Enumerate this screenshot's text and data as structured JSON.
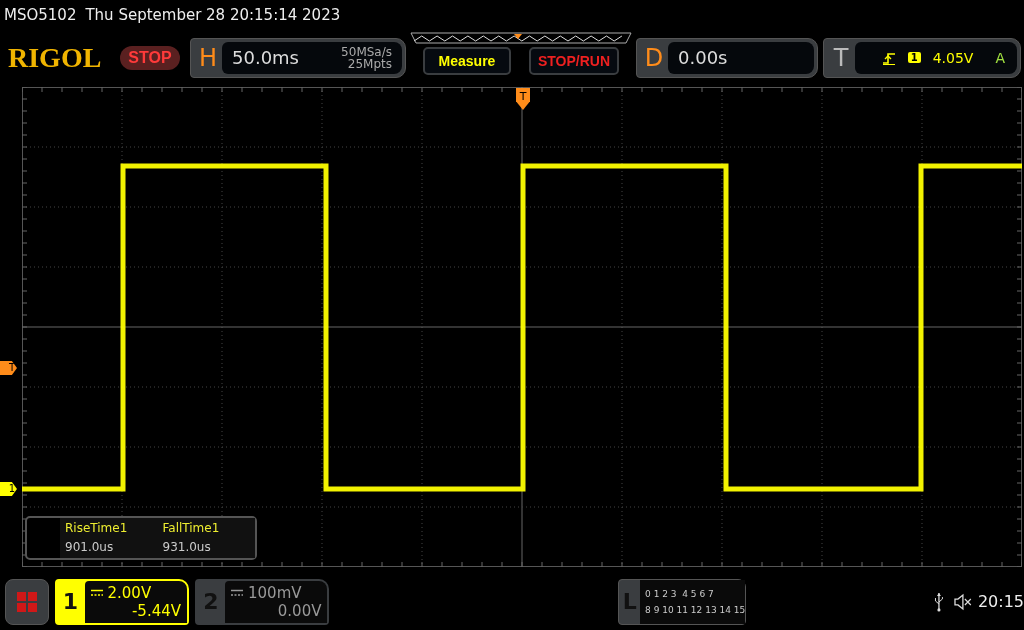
{
  "header": {
    "model": "MSO5102",
    "datetime": "Thu September 28 20:15:14 2023"
  },
  "toolbar": {
    "logo": "RIGOL",
    "run_state": {
      "label": "STOP",
      "kind": "stop"
    },
    "horizontal": {
      "label": "H",
      "timebase": "50.0ms",
      "sample_rate": "50MSa/s",
      "memory_depth": "25Mpts"
    },
    "buttons": [
      "Measure",
      "STOP/RUN"
    ],
    "delay": {
      "label": "D",
      "value": "0.00s"
    },
    "trigger": {
      "label": "T",
      "source": "1",
      "level": "4.05V",
      "mode": "A"
    }
  },
  "display": {
    "trigger_position": {
      "label": "T"
    },
    "markers": [
      {
        "label": "T",
        "kind": "trigger",
        "color": "#ff8c1a"
      },
      {
        "label": "1",
        "kind": "channel",
        "color": "#ffff00"
      }
    ],
    "measurements": [
      {
        "name": "RiseTime1",
        "value": "901.0us"
      },
      {
        "name": "FallTime1",
        "value": "931.0us"
      }
    ]
  },
  "channels": [
    {
      "number": "1",
      "scale": "2.00V",
      "offset": "-5.44V",
      "selected": true
    },
    {
      "number": "2",
      "scale": "100mV",
      "offset": "0.00V",
      "selected": false
    }
  ],
  "logic": {
    "label": "L",
    "rows": [
      "0 1 2 3  4 5 6 7",
      "8 9 10 11 12 13 14 15"
    ]
  },
  "status": {
    "time": "20:15"
  }
}
